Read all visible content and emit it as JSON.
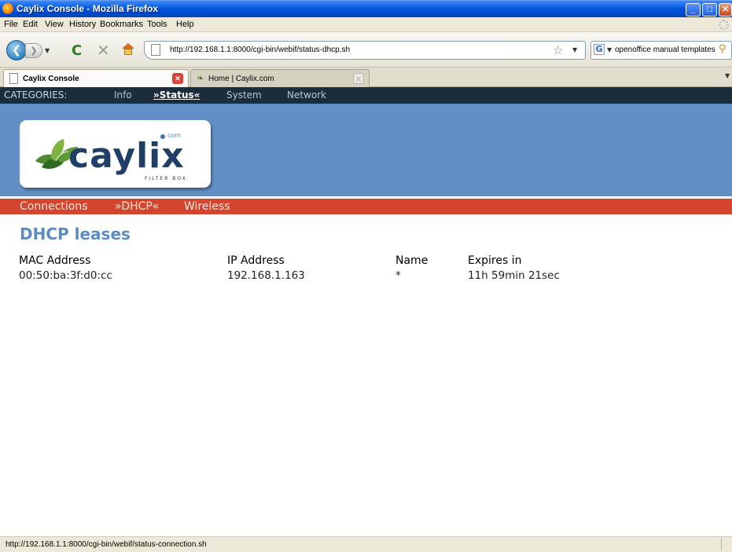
{
  "window": {
    "title": "Caylix Console - Mozilla Firefox"
  },
  "menu": [
    "File",
    "Edit",
    "View",
    "History",
    "Bookmarks",
    "Tools",
    "Help"
  ],
  "nav": {
    "url": "http://192.168.1.1:8000/cgi-bin/webif/status-dhcp.sh",
    "search": "openoffice manual templates"
  },
  "tabs": [
    {
      "label": "Caylix Console",
      "active": true
    },
    {
      "label": "Home | Caylix.com",
      "active": false
    }
  ],
  "categories": {
    "label": "CATEGORIES:",
    "items": [
      "Info",
      "»Status«",
      "System",
      "Network"
    ]
  },
  "logo": {
    "wordmark": "caylix",
    "dotcom": "com",
    "tagline": "FILTER BOX"
  },
  "subnav": [
    "Connections",
    "»DHCP«",
    "Wireless"
  ],
  "page": {
    "heading": "DHCP leases",
    "columns": [
      "MAC Address",
      "IP Address",
      "Name",
      "Expires in"
    ],
    "rows": [
      [
        "00:50:ba:3f:d0:cc",
        "192.168.1.163",
        "*",
        "11h 59min 21sec"
      ]
    ]
  },
  "status": {
    "text": "http://192.168.1.1:8000/cgi-bin/webif/status-connection.sh"
  }
}
